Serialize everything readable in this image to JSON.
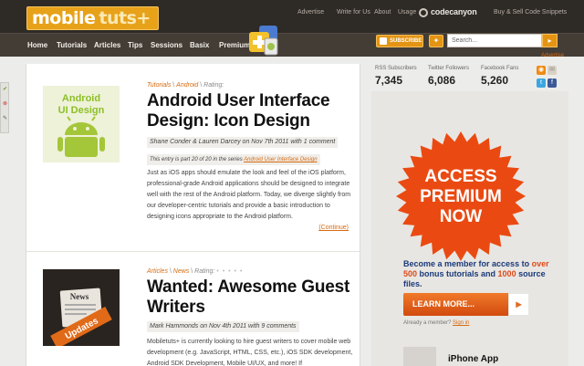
{
  "header": {
    "logo_part1": "mobile",
    "logo_part2": "tuts+",
    "top_links": [
      "Advertise",
      "Write for Us",
      "About",
      "Usage"
    ],
    "codecanyon": "codecanyon",
    "snippets": "Buy & Sell Code Snippets"
  },
  "nav": {
    "items": [
      "Home",
      "Tutorials",
      "Articles",
      "Tips",
      "Sessions",
      "Basix",
      "Premium"
    ],
    "subscribe": "SUBSCRIBE",
    "search_value": "Search..."
  },
  "posts": [
    {
      "thumb_line1": "Android",
      "thumb_line2": "UI Design",
      "crumb1": "Tutorials",
      "crumb2": "Android",
      "rating": "Rating:",
      "title": "Android User Interface Design: Icon Design",
      "meta": "Shane Conder & Lauren Darcey on Nov 7th 2011 with 1 comment",
      "series_prefix": "This entry is part 20 of 20 in the series",
      "series_link": "Android User Interface Design",
      "excerpt": "Just as iOS apps should emulate the look and feel of the iOS platform, professional-grade Android applications should be designed to integrate well with the rest of the Android platform. Today, we diverge slightly from our developer-centric tutorials and provide a basic introduction to designing icons appropriate to the Android platform.",
      "continue": "(Continue)"
    },
    {
      "thumb_line1": "News",
      "thumb_line2": "Updates",
      "crumb1": "Articles",
      "crumb2": "News",
      "rating": "Rating:",
      "title": "Wanted: Awesome Guest Writers",
      "meta": "Mark Hammonds on Nov 4th 2011 with 9 comments",
      "excerpt": "Mobiletuts+ is currently looking to hire guest writers to cover mobile web development (e.g. JavaScript, HTML, CSS, etc.), iOS SDK development, Android SDK Development, Mobile UI/UX, and more! If"
    }
  ],
  "sidebar": {
    "advertise": "Advertise",
    "stats": [
      {
        "label": "RSS Subscribers",
        "value": "7,345"
      },
      {
        "label": "Twitter Followers",
        "value": "6,086"
      },
      {
        "label": "Facebook Fans",
        "value": "5,260"
      }
    ],
    "badge_line1": "ACCESS",
    "badge_line2": "PREMIUM",
    "badge_line3": "NOW",
    "promo_pre": "Become a member for access to ",
    "promo_hl1": "over 500",
    "promo_mid": " bonus tutorials and ",
    "promo_hl2": "1000",
    "promo_post": " source files.",
    "learn_more": "LEARN MORE...",
    "already": "Already a member?",
    "sign_in": "Sign in",
    "iphone_app": "iPhone App"
  },
  "colors": {
    "accent": "#e49414",
    "link": "#d76b12",
    "badge": "#ea4a12"
  }
}
